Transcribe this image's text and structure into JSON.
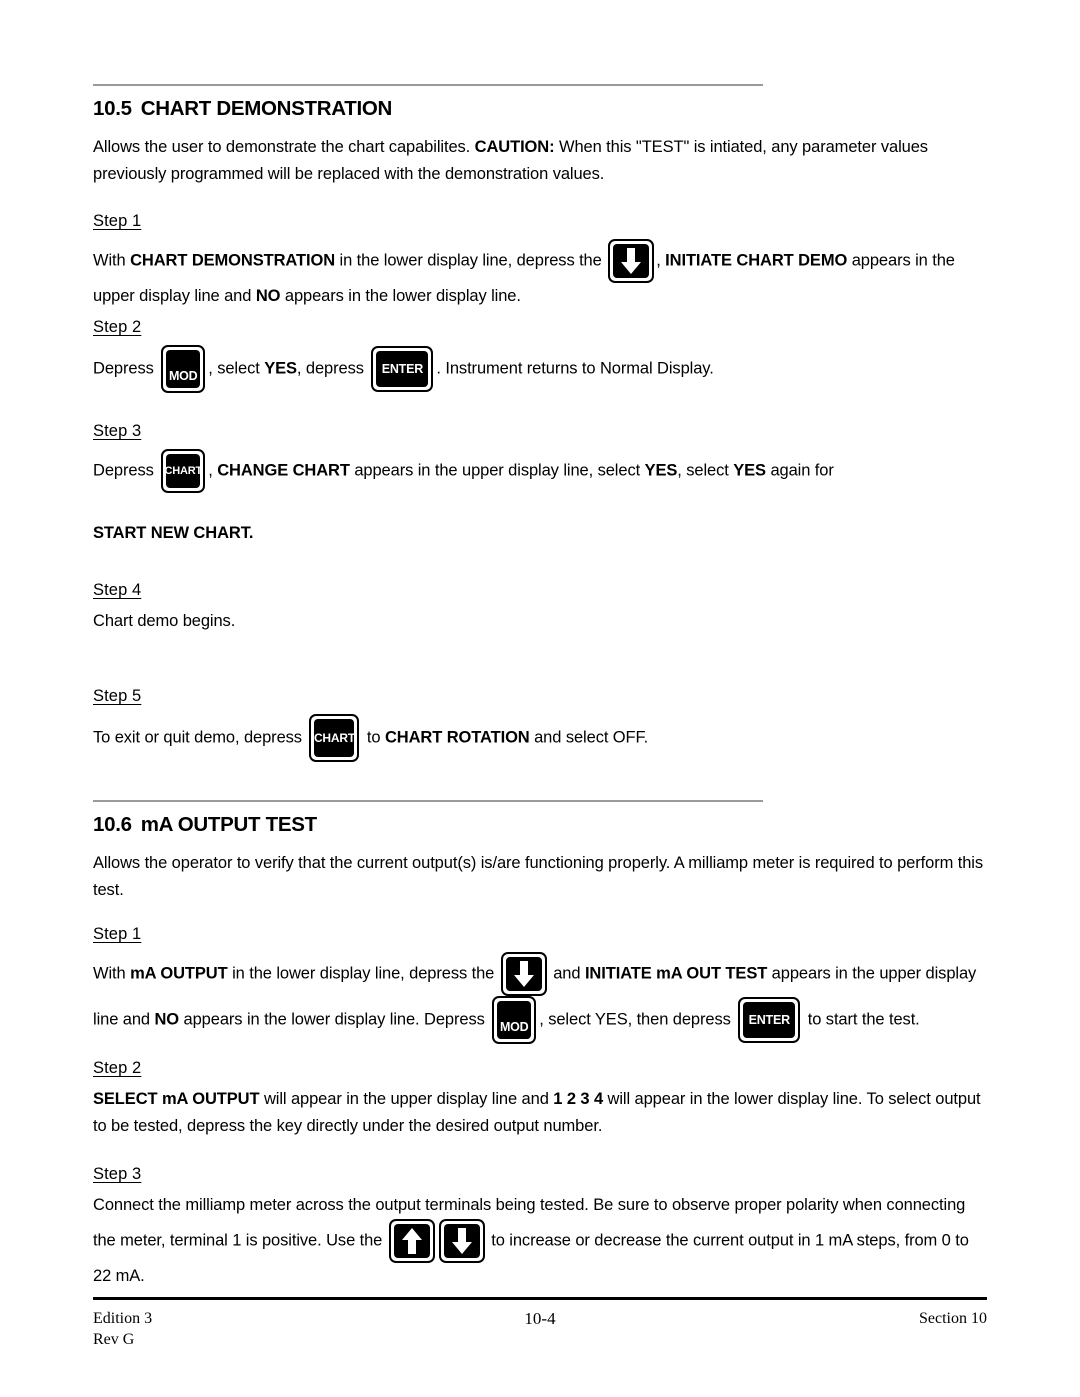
{
  "document": {
    "page_label": "10-4",
    "footer": {
      "edition": "Edition 3",
      "rev": "Rev G",
      "page_number": "10-4",
      "section": "Section 10"
    }
  },
  "sections": [
    {
      "number": "10.5",
      "title": "CHART DEMONSTRATION",
      "intro": {
        "part1": "Allows the user to demonstrate the chart capabilites.  ",
        "caution_label": "CAUTION:",
        "part2": "  When this \"TEST\" is intiated, any parameter values previously programmed will be replaced with the demonstration values."
      },
      "steps": [
        {
          "label": "Step 1",
          "t1": "With ",
          "b1": "CHART DEMONSTRATION",
          "t2": " in the lower display line, depress the ",
          "key1": "down-arrow",
          "t3": ", ",
          "b2": "INITIATE CHART DEMO",
          "t4": " appears in the upper display line and ",
          "b3": "NO",
          "t5": " appears in the lower display line."
        },
        {
          "label": "Step 2",
          "t1": "Depress ",
          "key1": "MOD",
          "t2": ", select ",
          "b1": "YES",
          "t3": ", depress ",
          "key2": "ENTER",
          "t4": ".  Instrument returns to Normal Display."
        },
        {
          "label": "Step 3",
          "t1": "Depress ",
          "key1": "CHART",
          "t2": ", ",
          "b1": "CHANGE CHART",
          "t3": " appears in the upper display line, select ",
          "b2": "YES",
          "t4": ", select ",
          "b3": "YES",
          "t5": " again for",
          "emphasis_line": "START NEW CHART."
        },
        {
          "label": "Step 4",
          "t1": "Chart demo begins."
        },
        {
          "label": "Step 5",
          "t1": "To exit or quit demo, depress ",
          "key1": "CHART",
          "t2": " to ",
          "b1": "CHART ROTATION",
          "t3": " and select OFF."
        }
      ]
    },
    {
      "number": "10.6",
      "title": "mA OUTPUT TEST",
      "intro": {
        "part1": "Allows the operator to verify that the current output(s) is/are functioning properly.  A milliamp meter is required to perform this test."
      },
      "steps": [
        {
          "label": "Step 1",
          "t1": "With ",
          "b1": "mA OUTPUT",
          "t2": " in the lower display line, depress the ",
          "key1": "down-arrow",
          "t3": " and ",
          "b2": "INITIATE mA OUT TEST",
          "t4": " appears in the upper display line and ",
          "b3": "NO",
          "t5": " appears in the lower display line.  Depress ",
          "key2": "MOD",
          "t6": ", select YES, then depress ",
          "key3": "ENTER",
          "t7": " to start the test."
        },
        {
          "label": "Step 2",
          "b1": "SELECT mA OUTPUT",
          "t1": " will appear in the upper display line and ",
          "b2": "1  2  3  4",
          "t2": "  will appear in the lower display line.  To select output to be tested, depress the key directly under the desired output number."
        },
        {
          "label": "Step 3",
          "t1": "Connect the milliamp meter across the output terminals being tested.  Be sure to observe proper polarity when connecting the meter, terminal 1 is positive.  Use  the ",
          "key1": "up-arrow",
          "key2": "down-arrow",
          "t2": " to increase or decrease the current output in 1 mA steps, from 0 to 22 mA."
        }
      ]
    }
  ],
  "keys": {
    "mod_label": "MOD",
    "enter_label": "ENTER",
    "chart_label": "CHART"
  },
  "colors": {
    "key_face": "#000000",
    "key_text": "#ffffff",
    "rule": "#9a9a9a",
    "footer_rule": "#000000",
    "text": "#000000"
  }
}
